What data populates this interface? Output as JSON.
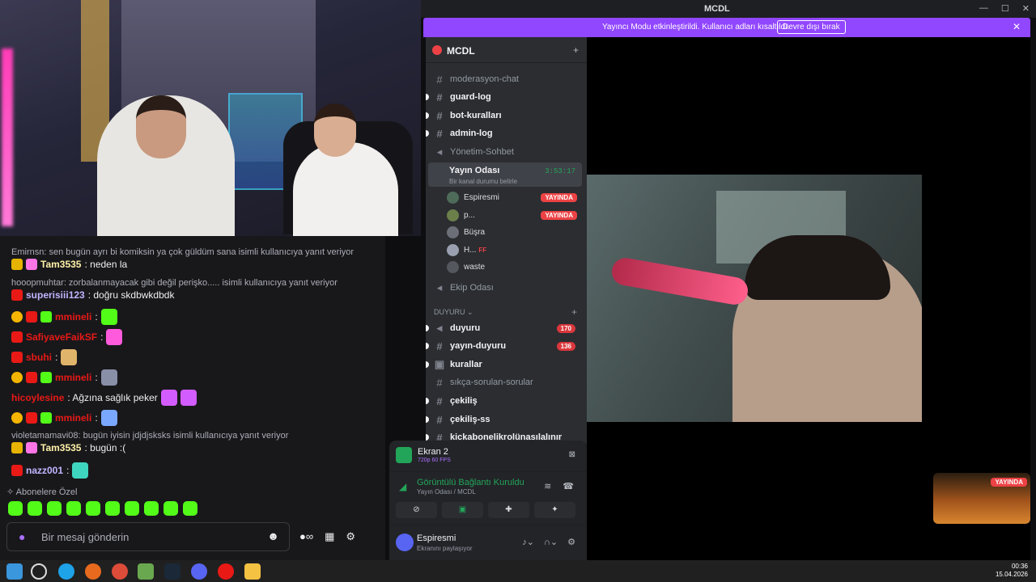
{
  "window": {
    "title": "MCDL"
  },
  "banner": {
    "text": "Yayıncı Modu etkinleştirildi. Kullanıcı adları kısaltıldı.",
    "button": "Devre dışı bırak"
  },
  "guild": {
    "name": "MCDL"
  },
  "channels": [
    {
      "label": "moderasyon-chat",
      "bright": false
    },
    {
      "label": "guard-log",
      "bright": true
    },
    {
      "label": "bot-kuralları",
      "bright": true
    },
    {
      "label": "admin-log",
      "bright": true
    },
    {
      "label": "Yönetim-Sohbet",
      "bright": false
    }
  ],
  "voice_active": {
    "name": "Yayın Odası",
    "time": "3:53:17",
    "status": "Bir kanal durumu belirle"
  },
  "voice_users": [
    {
      "name": "Espiresmi",
      "live": "YAYINDA"
    },
    {
      "name": "p...",
      "live": "YAYINDA"
    },
    {
      "name": "Büşra",
      "live": ""
    },
    {
      "name": "H...",
      "live": "",
      "extra": "FF"
    },
    {
      "name": "waste",
      "live": ""
    }
  ],
  "ekip": {
    "label": "Ekip Odası"
  },
  "category": {
    "label": "DUYURU"
  },
  "duyuru_channels": [
    {
      "label": "duyuru",
      "count": "170"
    },
    {
      "label": "yayın-duyuru",
      "count": "136"
    },
    {
      "label": "kurallar",
      "count": ""
    },
    {
      "label": "sıkça-sorulan-sorular",
      "count": ""
    },
    {
      "label": "çekiliş",
      "count": ""
    },
    {
      "label": "çekiliş-ss",
      "count": ""
    },
    {
      "label": "kickabonelikrolünasılalınır",
      "count": ""
    }
  ],
  "voice_panel": {
    "screen_name": "Ekran 2",
    "screen_info": "720p 60 FPS",
    "connection": "Görüntülü Bağlantı Kuruldu",
    "room": "Yayın Odası / MCDL",
    "user": "Espiresmi",
    "user_status": "Ekranını paylaşıyor"
  },
  "thumb_live": "YAYINDA",
  "chat": {
    "messages": [
      {
        "reply": "Emirnsn: sen bugün ayrı bi komiksin ya çok güldüm sana isimli kullanıcıya yanıt veriyor",
        "user": "Tam3535",
        "user_color": "#fff2a8",
        "text": ": neden la"
      },
      {
        "reply": "hooopmuhtar: zorbalanmayacak gibi değil perişko..... isimli kullanıcıya yanıt veriyor",
        "user": "superisiii123",
        "user_color": "#c0b5ff",
        "text": ": doğru skdbwkdbdk"
      },
      {
        "user": "mmineli",
        "user_color": "#e91916",
        "text": ":"
      },
      {
        "user": "SafiyaveFaikSF",
        "user_color": "#e91916",
        "text": ":"
      },
      {
        "user": "sbuhi",
        "user_color": "#e91916",
        "text": ":"
      },
      {
        "user": "mmineli",
        "user_color": "#e91916",
        "text": ":"
      },
      {
        "user": "hicoylesine",
        "user_color": "#e91916",
        "text": ": Ağzına sağlık peker"
      },
      {
        "user": "mmineli",
        "user_color": "#e91916",
        "text": ":"
      },
      {
        "reply": "violetamamavi08: bugün iyisin jdjdjsksks isimli kullanıcıya yanıt veriyor",
        "user": "Tam3535",
        "user_color": "#fff2a8",
        "text": ": bugün :("
      },
      {
        "user": "nazz001",
        "user_color": "#c0b5ff",
        "text": ":"
      }
    ],
    "sub_label": "Abonelere Özel",
    "placeholder": "Bir mesaj gönderin"
  },
  "clock": {
    "time": "00:36",
    "date": "15.04.2026"
  }
}
